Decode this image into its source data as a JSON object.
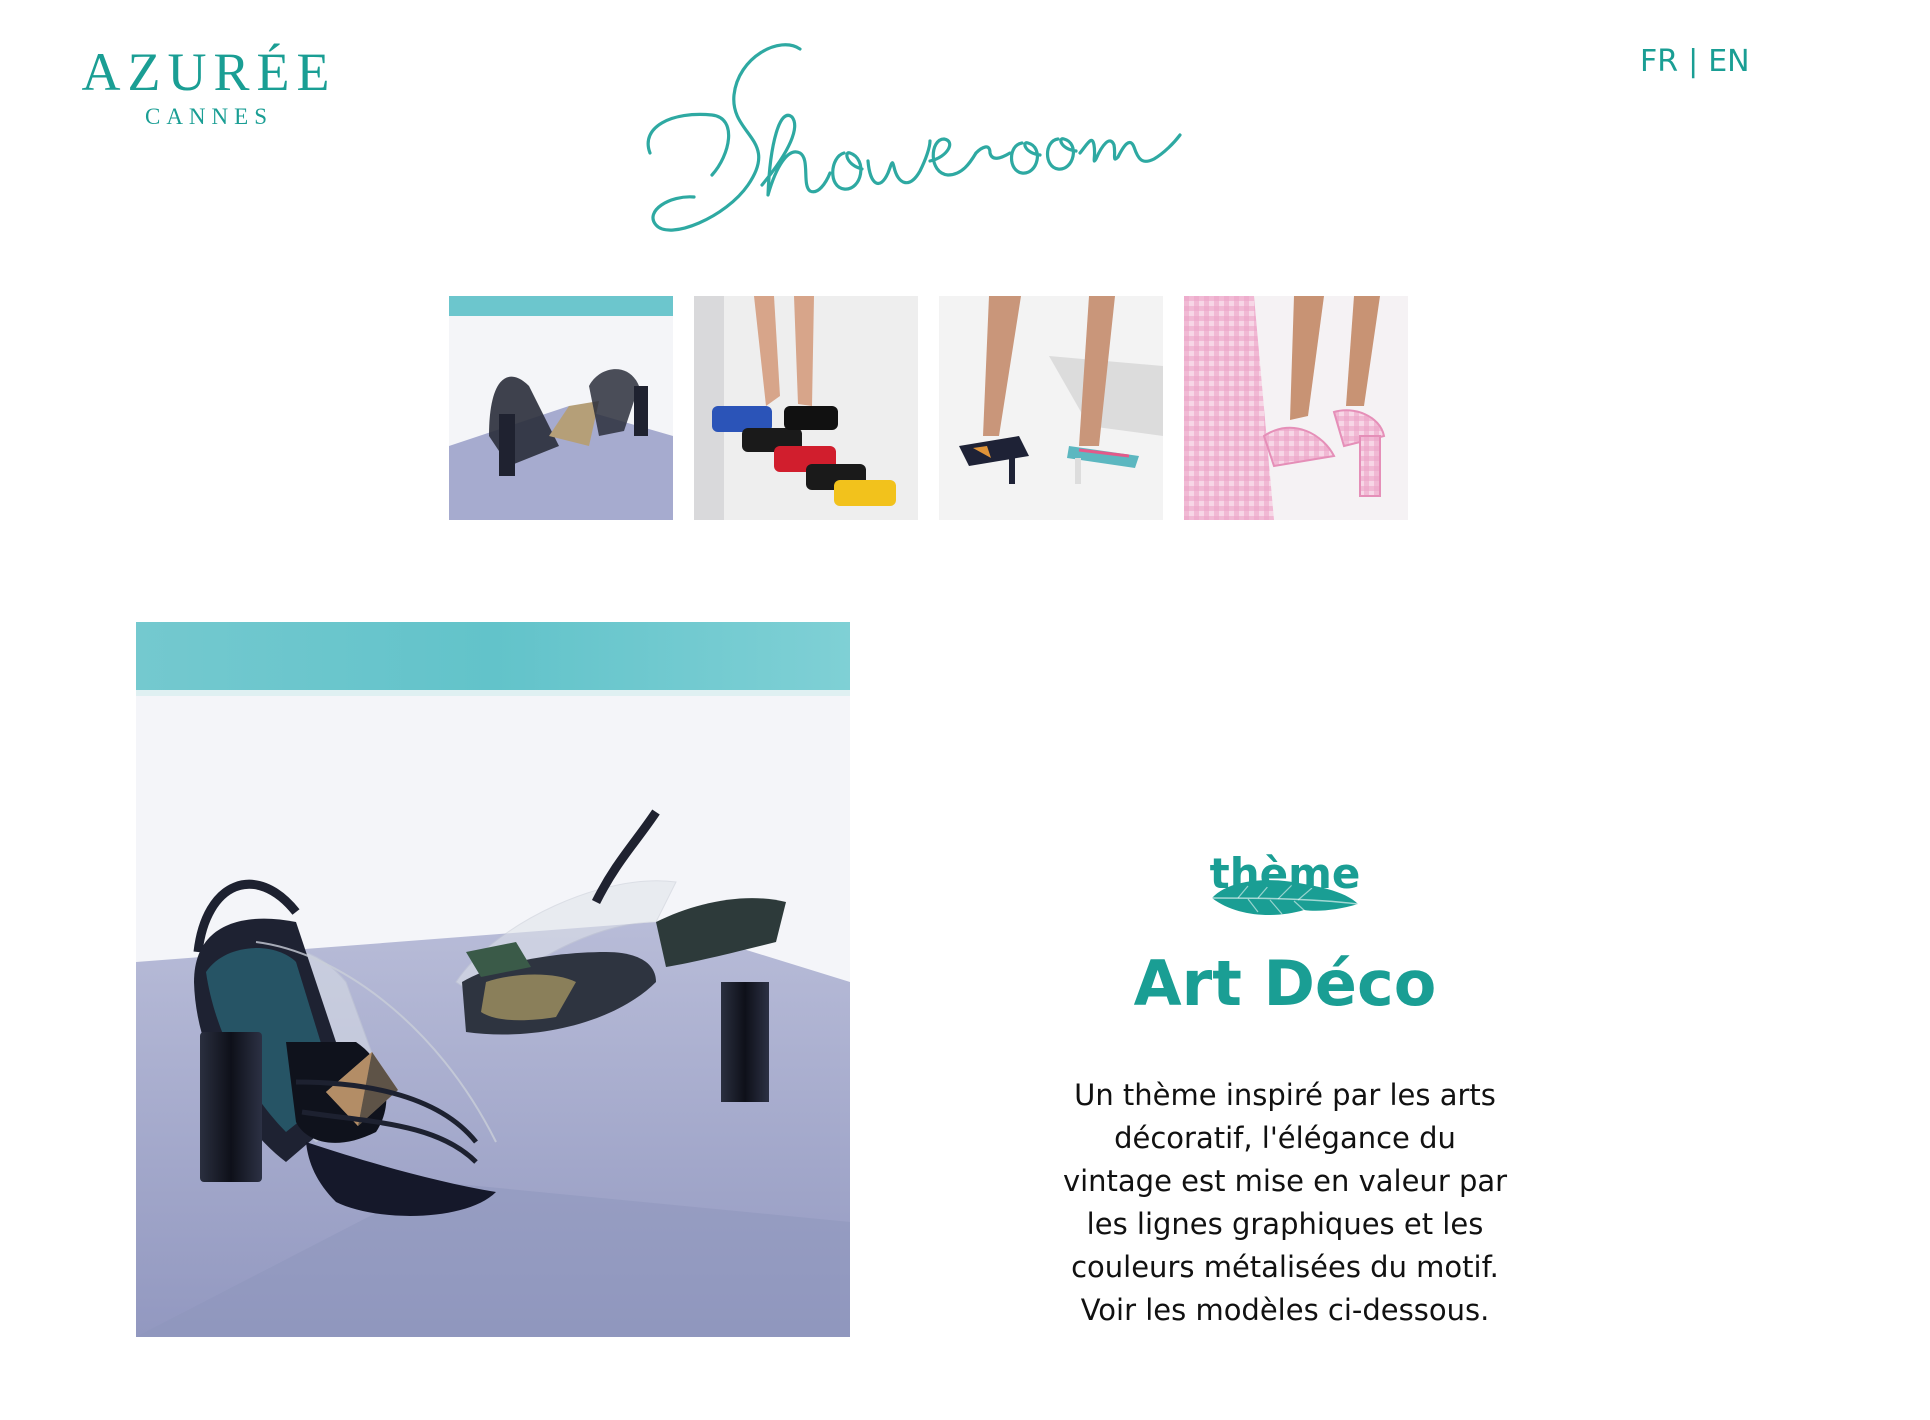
{
  "header": {
    "logo_main": "AZURÉE",
    "logo_sub": "CANNES",
    "title": "Showroom",
    "languages": [
      "FR",
      "EN"
    ],
    "language_separator": "|"
  },
  "thumbnails": [
    {
      "icon": "art-deco-sandal-thumbnail"
    },
    {
      "icon": "colorful-mules-thumbnail"
    },
    {
      "icon": "striped-heels-thumbnail"
    },
    {
      "icon": "pink-gingham-sandals-thumbnail"
    }
  ],
  "feature": {
    "label": "thème",
    "title": "Art Déco",
    "description_lines": [
      "Un thème inspiré par les arts",
      "décoratif, l'élégance du",
      "vintage est mise en valeur par",
      "les lignes graphiques et les",
      "couleurs métalisées du motif.",
      "Voir les modèles ci-dessous."
    ]
  },
  "colors": {
    "brand_teal": "#1a9e94",
    "text": "#111111",
    "pool": "#62c5cc",
    "floor": "#a4a9cc"
  }
}
